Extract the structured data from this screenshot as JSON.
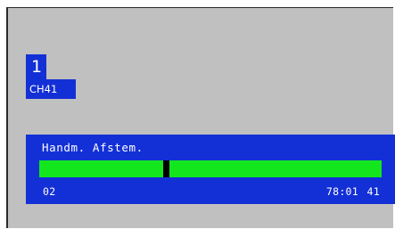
{
  "channel": {
    "number": "1",
    "name": "CH41"
  },
  "manual_tuning": {
    "title": "Handm. Afstem.",
    "left_value": "02",
    "middle_value": "78:01",
    "right_value": "41",
    "level_fraction": 0.369,
    "bar_color": "#14e61e",
    "panel_color": "#1330d6"
  }
}
